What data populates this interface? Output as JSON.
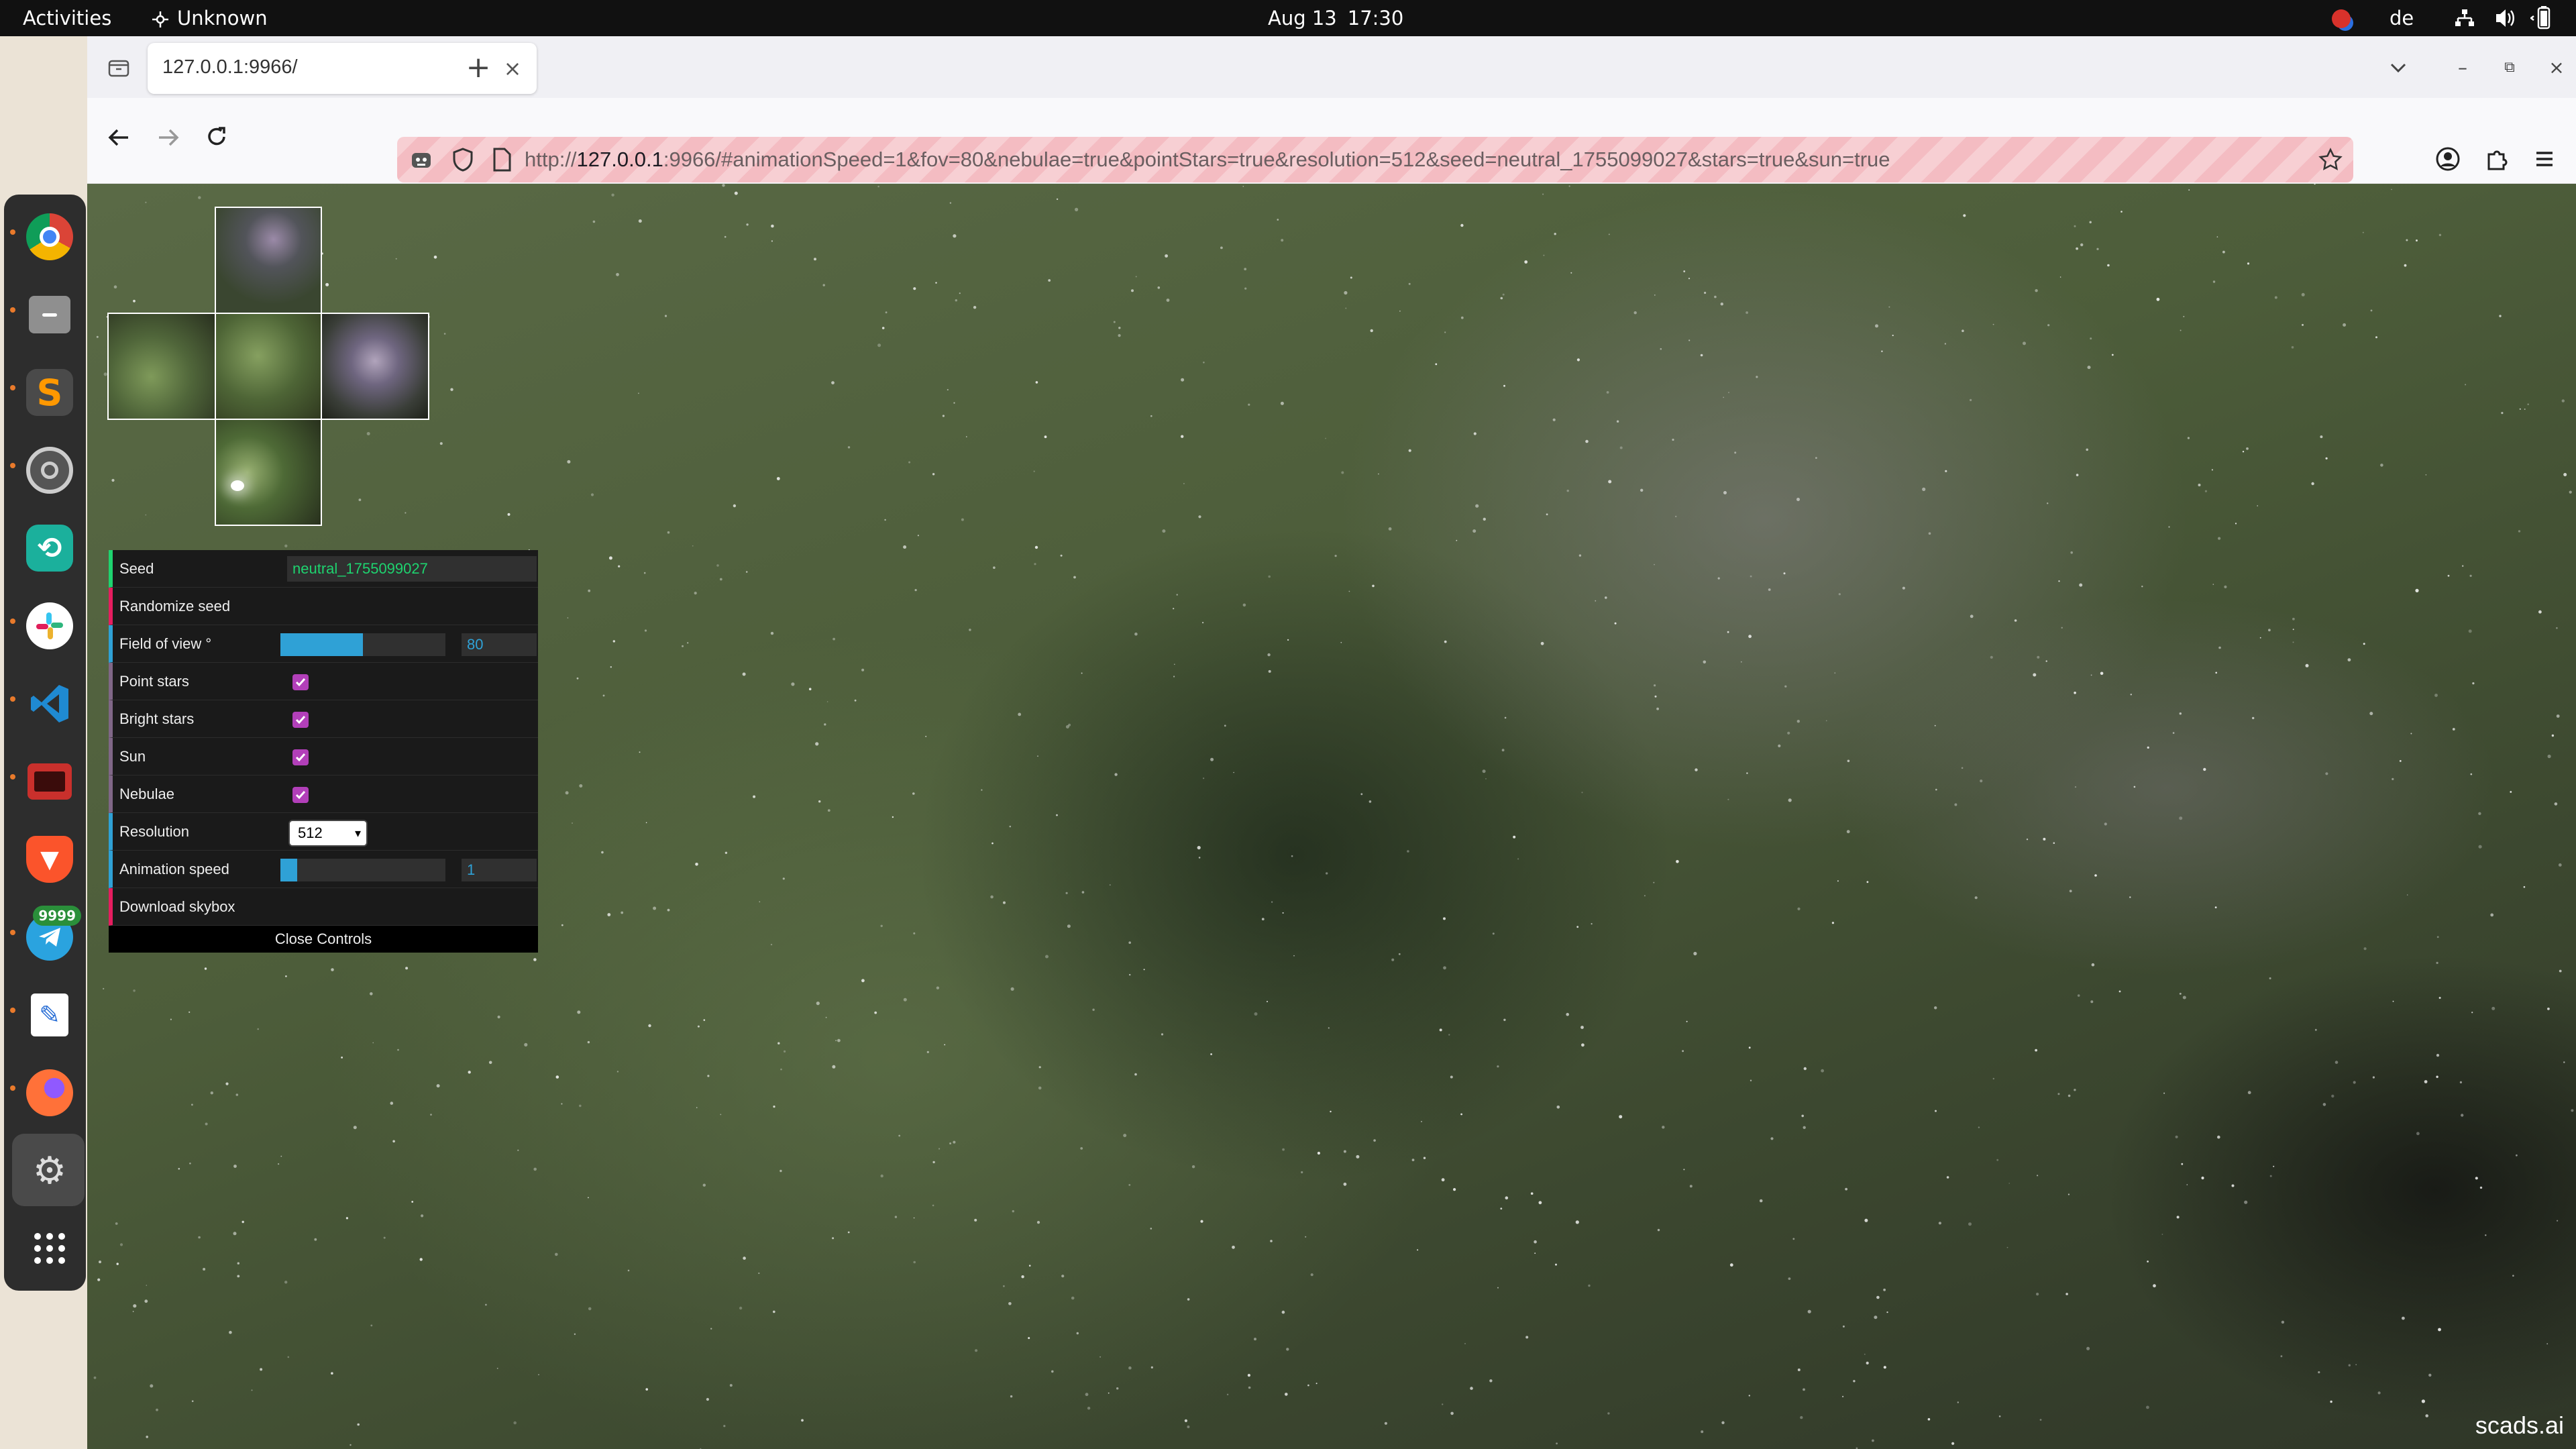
{
  "topbar": {
    "activities": "Activities",
    "app_name": "Unknown",
    "date": "Aug 13",
    "time": "17:30",
    "lang": "de"
  },
  "dock": {
    "items": [
      {
        "name": "chrome",
        "running": true
      },
      {
        "name": "files",
        "running": true
      },
      {
        "name": "sublime-text",
        "running": true
      },
      {
        "name": "settings-gear",
        "running": true
      },
      {
        "name": "gitkraken",
        "running": false
      },
      {
        "name": "slack",
        "running": true
      },
      {
        "name": "vscode",
        "running": true
      },
      {
        "name": "terminal",
        "running": true
      },
      {
        "name": "brave",
        "running": false
      },
      {
        "name": "telegram",
        "running": true,
        "badge": "9999"
      },
      {
        "name": "text-editor",
        "running": true
      },
      {
        "name": "firefox",
        "running": true
      },
      {
        "name": "settings",
        "running": false,
        "active": true
      },
      {
        "name": "app-grid",
        "running": false
      }
    ]
  },
  "browser": {
    "tab_title": "127.0.0.1:9966/",
    "url_scheme": "http://",
    "url_host": "127.0.0.1",
    "url_rest": ":9966/#animationSpeed=1&fov=80&nebulae=true&pointStars=true&resolution=512&seed=neutral_1755099027&stars=true&sun=true"
  },
  "gui": {
    "seed_label": "Seed",
    "seed_value": "neutral_1755099027",
    "randomize_label": "Randomize seed",
    "fov_label": "Field of view °",
    "fov_value": "80",
    "fov_fraction": 0.5,
    "point_stars_label": "Point stars",
    "point_stars": true,
    "bright_stars_label": "Bright stars",
    "bright_stars": true,
    "sun_label": "Sun",
    "sun": true,
    "nebulae_label": "Nebulae",
    "nebulae": true,
    "resolution_label": "Resolution",
    "resolution_value": "512",
    "anim_label": "Animation speed",
    "anim_value": "1",
    "anim_fraction": 0.1,
    "download_label": "Download skybox",
    "close_label": "Close Controls"
  },
  "watermark": "scads.ai",
  "colors": {
    "gui_text_accent": "#1ed36f",
    "gui_number_accent": "#2fa1d6",
    "gui_function_accent": "#e61d5f",
    "checkbox": "#b23fb9"
  }
}
